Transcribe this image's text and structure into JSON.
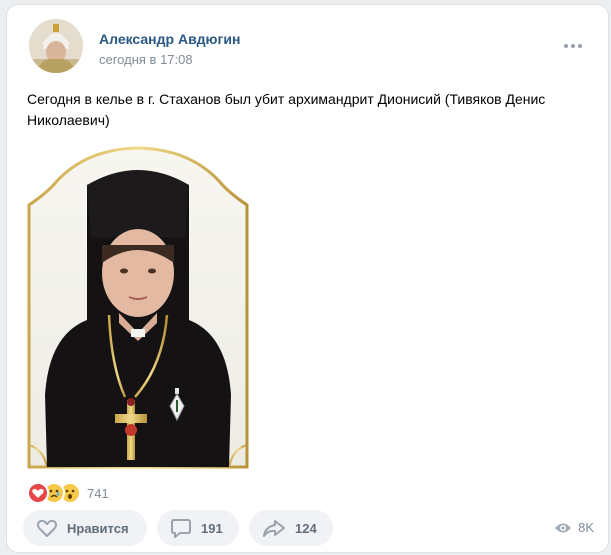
{
  "post": {
    "author": "Александр Авдюгин",
    "time": "сегодня в 17:08",
    "text": "Сегодня в келье в г. Стаханов был убит архимандрит Дионисий (Тивяков Денис Николаевич)"
  },
  "reactions": {
    "emojis": [
      "heart-reaction",
      "sad-reaction",
      "surprised-reaction"
    ],
    "count": "741"
  },
  "actions": {
    "like_label": "Нравится",
    "comments_count": "191",
    "shares_count": "124"
  },
  "views": {
    "count": "8K"
  },
  "icons": {
    "more": "more-horizontal-icon",
    "like": "heart-outline-icon",
    "comment": "comment-icon",
    "share": "share-arrow-icon",
    "views": "eye-icon"
  },
  "colors": {
    "author_link": "#2a5885",
    "secondary_text": "#818c99",
    "button_bg": "#f0f2f5",
    "button_text": "#626d7a"
  }
}
